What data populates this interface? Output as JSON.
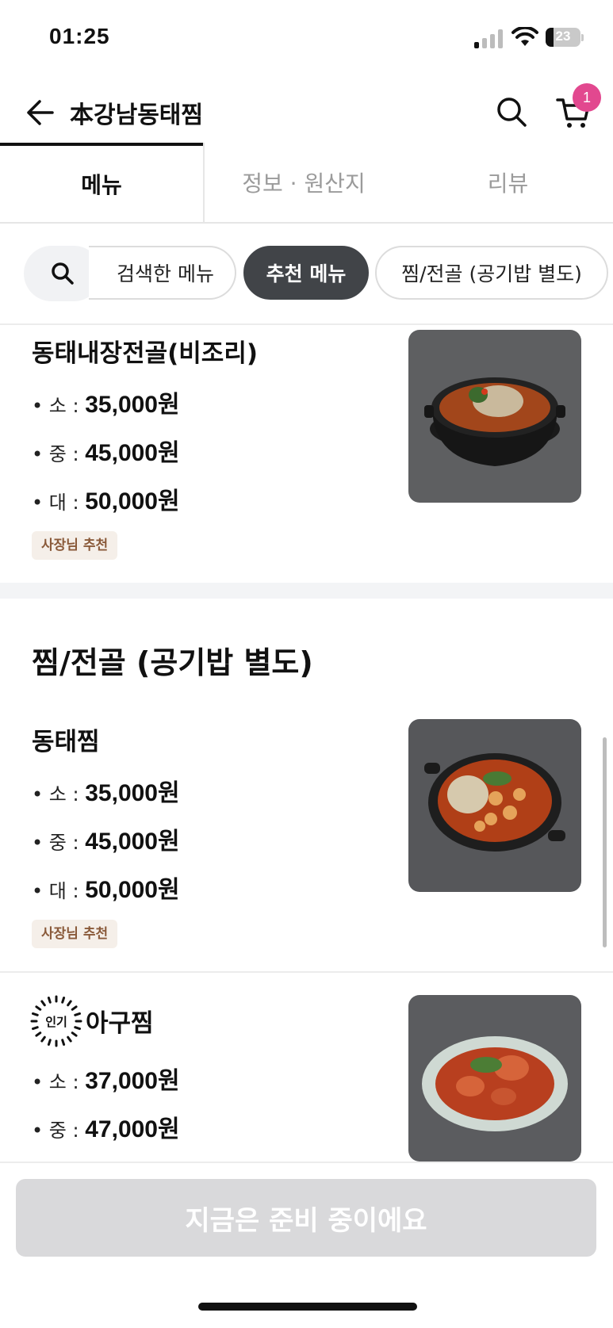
{
  "status_bar": {
    "time": "01:25",
    "battery": "23",
    "battery_level_percent": 23
  },
  "header": {
    "title": "本강남동태찜",
    "cart_count": "1"
  },
  "tabs": [
    {
      "label": "메뉴",
      "active": true
    },
    {
      "label": "정보 · 원산지",
      "active": false
    },
    {
      "label": "리뷰",
      "active": false
    }
  ],
  "chips": [
    {
      "label": "검색한 메뉴",
      "active": false
    },
    {
      "label": "추천 메뉴",
      "active": true
    },
    {
      "label": "찜/전골 (공기밥 별도)",
      "active": false
    }
  ],
  "items": [
    {
      "name": "동태내장전골(비조리)",
      "prices": [
        {
          "size": "• 소 :",
          "amount": "35,000원"
        },
        {
          "size": "• 중 :",
          "amount": "45,000원"
        },
        {
          "size": "• 대 :",
          "amount": "50,000원"
        }
      ],
      "badge": "사장님 추천"
    }
  ],
  "section": {
    "title": "찜/전골 (공기밥 별도)",
    "items": [
      {
        "name": "동태찜",
        "prices": [
          {
            "size": "• 소 :",
            "amount": "35,000원"
          },
          {
            "size": "• 중 :",
            "amount": "45,000원"
          },
          {
            "size": "• 대 :",
            "amount": "50,000원"
          }
        ],
        "badge": "사장님 추천"
      },
      {
        "popular_label": "인기",
        "name": "아구찜",
        "prices": [
          {
            "size": "• 소 :",
            "amount": "37,000원"
          },
          {
            "size": "• 중 :",
            "amount": "47,000원"
          }
        ]
      }
    ]
  },
  "cta": {
    "label": "지금은 준비 중이에요"
  },
  "colors": {
    "badge_pink": "#e2488f",
    "active_chip": "#414448",
    "owner_badge_bg": "#f5efe9",
    "owner_badge_text": "#8a5a3a",
    "cta_disabled": "#d9d9db"
  }
}
